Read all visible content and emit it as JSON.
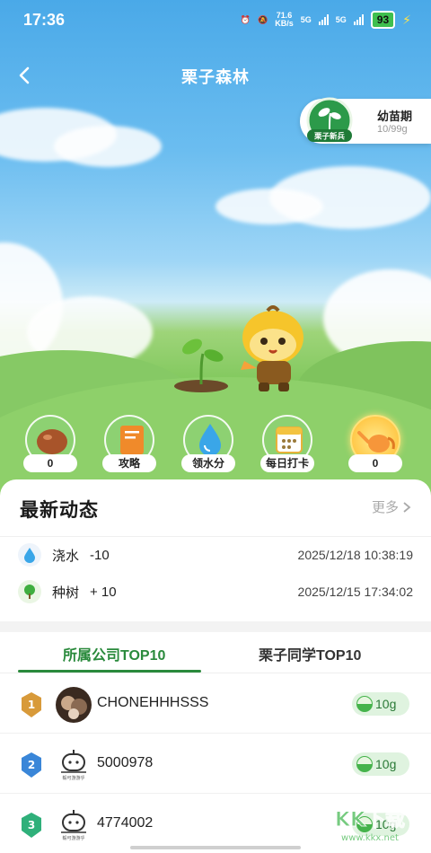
{
  "status": {
    "time": "17:36",
    "net_speed": "71.6",
    "net_unit": "KB/s",
    "sim1": "5G",
    "sim2": "5G",
    "battery": "93"
  },
  "nav": {
    "title": "栗子森林"
  },
  "stage": {
    "badge_text": "栗子新兵",
    "name": "幼苗期",
    "progress": "10/99g"
  },
  "actions": [
    {
      "icon": "chestnut-icon",
      "label": "0"
    },
    {
      "icon": "book-icon",
      "label": "攻略"
    },
    {
      "icon": "water-drop-icon",
      "label": "领水分"
    },
    {
      "icon": "calendar-icon",
      "label": "每日打卡"
    },
    {
      "icon": "watering-can-icon",
      "label": "0"
    }
  ],
  "news": {
    "title": "最新动态",
    "more": "更多",
    "items": [
      {
        "icon": "water-drop-icon",
        "action": "浇水",
        "amount": "-10",
        "time": "2025/12/18 10:38:19"
      },
      {
        "icon": "tree-icon",
        "action": "种树",
        "amount": "+ 10",
        "time": "2025/12/15 17:34:02"
      }
    ]
  },
  "tabs": [
    {
      "label": "所属公司TOP10",
      "active": true
    },
    {
      "label": "栗子同学TOP10",
      "active": false
    }
  ],
  "ranking": [
    {
      "rank": "1",
      "name": "CHONEHHHSSS",
      "amount": "10g",
      "medal_color": "#d89a3a"
    },
    {
      "rank": "2",
      "name": "5000978",
      "amount": "10g",
      "medal_color": "#3a86d8"
    },
    {
      "rank": "3",
      "name": "4774002",
      "amount": "10g",
      "medal_color": "#2fb07a"
    }
  ],
  "avatar_caption": "毅可游游乎",
  "watermark": {
    "brand": "KK下载",
    "url": "www.kkx.net"
  }
}
